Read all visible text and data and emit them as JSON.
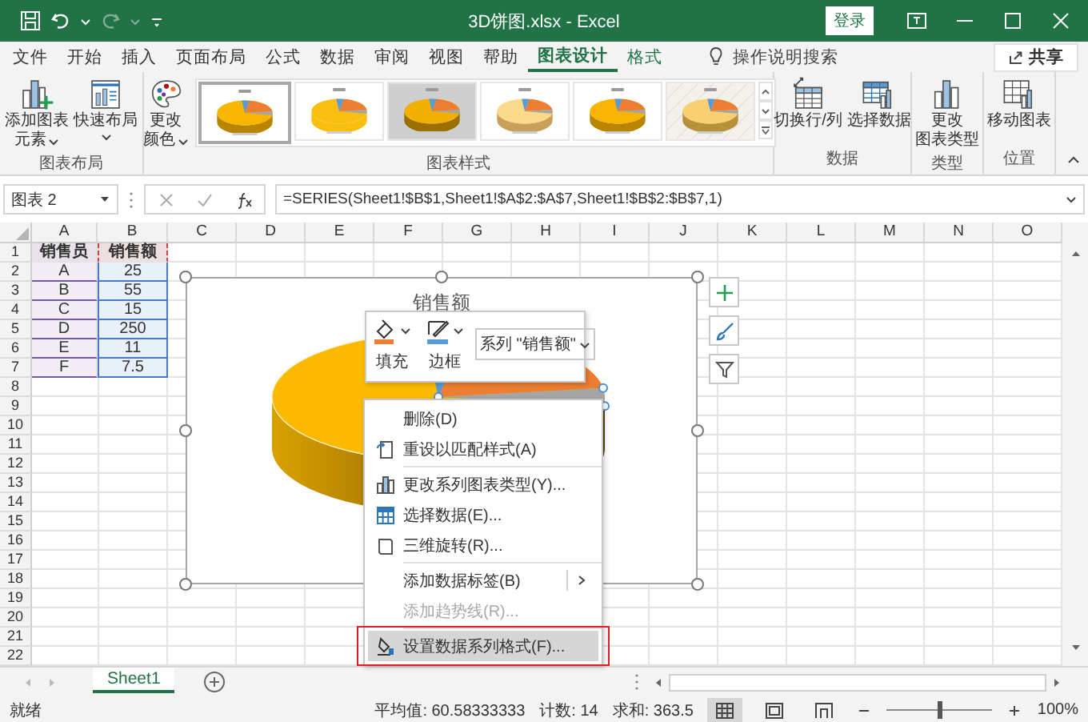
{
  "window": {
    "title": "3D饼图.xlsx  -  Excel",
    "sign_in": "登录"
  },
  "ribbon_tabs": [
    {
      "label": "文件",
      "selected": false,
      "contextual": false
    },
    {
      "label": "开始",
      "selected": false,
      "contextual": false
    },
    {
      "label": "插入",
      "selected": false,
      "contextual": false
    },
    {
      "label": "页面布局",
      "selected": false,
      "contextual": false
    },
    {
      "label": "公式",
      "selected": false,
      "contextual": false
    },
    {
      "label": "数据",
      "selected": false,
      "contextual": false
    },
    {
      "label": "审阅",
      "selected": false,
      "contextual": false
    },
    {
      "label": "视图",
      "selected": false,
      "contextual": false
    },
    {
      "label": "帮助",
      "selected": false,
      "contextual": false
    },
    {
      "label": "图表设计",
      "selected": true,
      "contextual": true
    },
    {
      "label": "格式",
      "selected": false,
      "contextual": true
    }
  ],
  "tell_me": "操作说明搜索",
  "share": "共享",
  "ribbon_groups": [
    {
      "label": "图表布局",
      "commands": [
        {
          "kind": "add-element",
          "lines": [
            "添加图表",
            "元素"
          ],
          "dropdown": true
        },
        {
          "kind": "quick-layout",
          "lines": [
            "快速布局"
          ],
          "dropdown": true
        }
      ]
    },
    {
      "label": "图表样式",
      "commands": [
        {
          "kind": "palette",
          "lines": [
            "更改",
            "颜色"
          ],
          "dropdown": true
        }
      ],
      "styles": [
        {
          "kind": "glossy",
          "selected": true
        },
        {
          "kind": "flat",
          "selected": false
        },
        {
          "kind": "dark",
          "selected": false
        },
        {
          "kind": "pale",
          "selected": false
        },
        {
          "kind": "glossy",
          "selected": false
        },
        {
          "kind": "pale-hatched",
          "selected": false
        }
      ]
    },
    {
      "label": "数据",
      "commands": [
        {
          "kind": "switch",
          "lines": [
            "切换行/列"
          ],
          "dropdown": false
        },
        {
          "kind": "select-data",
          "lines": [
            "选择数据"
          ],
          "dropdown": false
        }
      ]
    },
    {
      "label": "类型",
      "commands": [
        {
          "kind": "chart-type",
          "lines": [
            "更改",
            "图表类型"
          ],
          "dropdown": false
        }
      ]
    },
    {
      "label": "位置",
      "commands": [
        {
          "kind": "move",
          "lines": [
            "移动图表"
          ],
          "dropdown": false
        }
      ]
    }
  ],
  "formula_bar": {
    "name_box": "图表 2",
    "formula": "=SERIES(Sheet1!$B$1,Sheet1!$A$2:$A$7,Sheet1!$B$2:$B$7,1)"
  },
  "sheet": {
    "columns": [
      "A",
      "B",
      "C",
      "D",
      "E",
      "F",
      "G",
      "H",
      "I",
      "J",
      "K",
      "L",
      "M",
      "N",
      "O"
    ],
    "rows": [
      "1",
      "2",
      "3",
      "4",
      "5",
      "6",
      "7",
      "8",
      "9",
      "10",
      "11",
      "12",
      "13",
      "14",
      "15",
      "16",
      "17",
      "18",
      "19",
      "20",
      "21",
      "22"
    ]
  },
  "table": {
    "header": [
      "销售员",
      "销售额"
    ],
    "rows": [
      [
        "A",
        "25"
      ],
      [
        "B",
        "55"
      ],
      [
        "C",
        "15"
      ],
      [
        "D",
        "250"
      ],
      [
        "E",
        "11"
      ],
      [
        "F",
        "7.5"
      ]
    ]
  },
  "chart": {
    "title": "销售额"
  },
  "mini_toolbar": {
    "fill": "填充",
    "border": "边框",
    "series": "系列 \"销售额\""
  },
  "context_menu": [
    [
      {
        "label": "删除(D)",
        "selected": false,
        "disabled": false,
        "submenu": false,
        "framed": false
      },
      {
        "label": "重设以匹配样式(A)",
        "selected": false,
        "disabled": false,
        "submenu": false,
        "framed": false
      }
    ],
    [
      {
        "label": "更改系列图表类型(Y)...",
        "selected": false,
        "disabled": false,
        "submenu": false,
        "framed": false
      },
      {
        "label": "选择数据(E)...",
        "selected": false,
        "disabled": false,
        "submenu": false,
        "framed": false
      },
      {
        "label": "三维旋转(R)...",
        "selected": false,
        "disabled": false,
        "submenu": false,
        "framed": false
      }
    ],
    [
      {
        "label": "添加数据标签(B)",
        "selected": false,
        "disabled": false,
        "submenu": true,
        "framed": false
      },
      {
        "label": "添加趋势线(R)...",
        "selected": false,
        "disabled": true,
        "submenu": false,
        "framed": false
      }
    ],
    [
      {
        "label": "设置数据系列格式(F)...",
        "selected": true,
        "disabled": false,
        "submenu": false,
        "framed": true
      }
    ]
  ],
  "sheet_tabs": [
    {
      "label": "Sheet1",
      "selected": true
    }
  ],
  "status_bar": {
    "ready": "就绪",
    "stats": [
      "平均值: 60.58333333",
      "计数: 14",
      "求和: 363.5"
    ],
    "views": [
      {
        "kind": "normal",
        "selected": true
      },
      {
        "kind": "page-layout",
        "selected": false
      },
      {
        "kind": "page-break",
        "selected": false
      }
    ],
    "zoom": {
      "level": 0.5,
      "reading": "100%"
    }
  }
}
